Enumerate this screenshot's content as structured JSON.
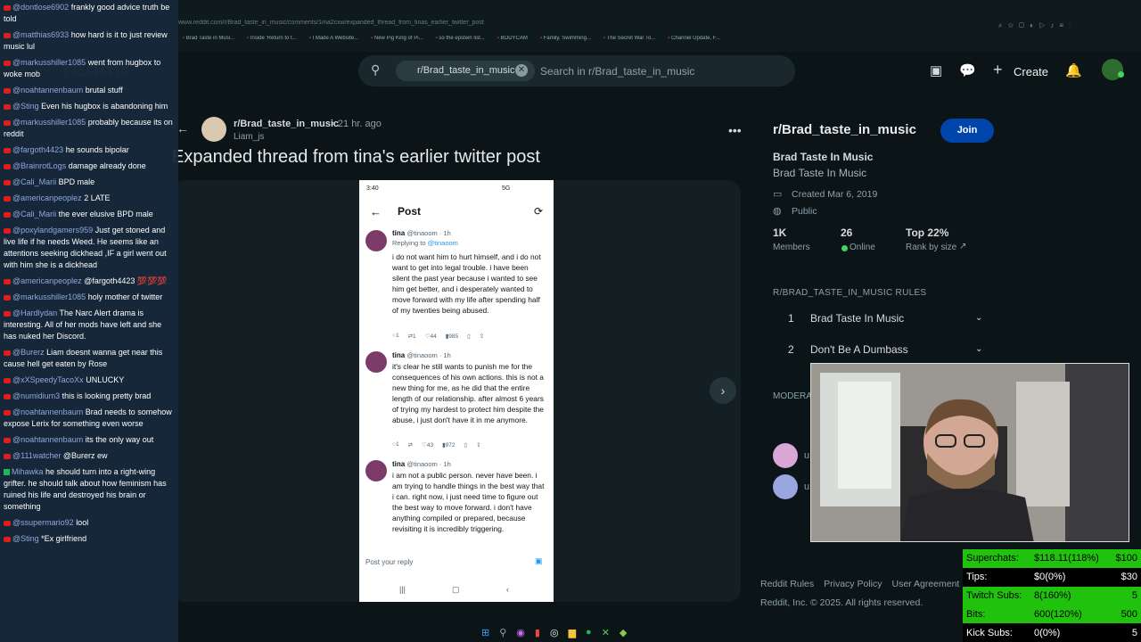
{
  "browser": {
    "url": "www.reddit.com/r/Brad_taste_in_music/comments/1ma2cxw/expanded_thread_from_tinas_earlier_twitter_post",
    "bookmarks": [
      "Brad Taste in Musi...",
      "Inside 'Return to t...",
      "I Made A Website...",
      "New Pig King of Pi...",
      "so the epstein list...",
      "BODYCAM",
      "Family, Swimming...",
      "The Secret War To...",
      "Channel Update, F..."
    ]
  },
  "reddit": {
    "logo": "reddit",
    "search": {
      "chip": "r/Brad_taste_in_music",
      "placeholder": "Search in r/Brad_taste_in_music"
    },
    "header": {
      "create_label": "Create"
    }
  },
  "post": {
    "subreddit": "r/Brad_taste_in_music",
    "time": "• 21 hr. ago",
    "author": "Liam_js",
    "title": "Expanded thread from tina's earlier twitter post"
  },
  "tweet_screenshot": {
    "status_time": "3:40",
    "status_right": "5G",
    "header": "Post",
    "tweets": [
      {
        "name": "tina",
        "handle": "@tinaoom · 1h",
        "reply_to_label": "Replying to",
        "reply_to": "@tinaoom",
        "text": "i do not want him to hurt himself, and i do not want to get into legal trouble. i have been silent the past year because i wanted to see him get better, and i desperately wanted to move forward with my life after spending half of my twenties being abused.",
        "replies": "1",
        "retweets": "1",
        "likes": "44",
        "views": "985"
      },
      {
        "name": "tina",
        "handle": "@tinaoom · 1h",
        "text": "it's clear he still wants to punish me for the consequences of his own actions. this is not a new thing for me, as he did that the entire length of our relationship. after almost 6 years of trying my hardest to protect him despite the abuse, i just don't have it in me anymore.",
        "replies": "1",
        "retweets": "",
        "likes": "43",
        "views": "972"
      },
      {
        "name": "tina",
        "handle": "@tinaoom · 1h",
        "text": "i am not a public person. never have been. i am trying to handle things in the best way that i can. right now, i just need time to figure out the best way to move forward. i don't have anything compiled or prepared, because revisiting it is incredibly triggering."
      }
    ],
    "reply_placeholder": "Post your reply"
  },
  "sidebar": {
    "title": "r/Brad_taste_in_music",
    "join_label": "Join",
    "display_name": "Brad Taste In Music",
    "description": "Brad Taste In Music",
    "created": "Created Mar 6, 2019",
    "visibility": "Public",
    "stats": [
      {
        "value": "1K",
        "label": "Members"
      },
      {
        "value": "26",
        "label": "Online"
      },
      {
        "value": "Top 22%",
        "label": "Rank by size"
      }
    ],
    "rules_heading": "R/BRAD_TASTE_IN_MUSIC RULES",
    "rules": [
      {
        "n": "1",
        "title": "Brad Taste In Music"
      },
      {
        "n": "2",
        "title": "Don't Be A Dumbass"
      }
    ],
    "moderators_heading": "MODERA",
    "mod_initial": "u",
    "footer_links": [
      "Reddit Rules",
      "Privacy Policy",
      "User Agreement",
      "Ac"
    ],
    "copyright": "Reddit, Inc. © 2025. All rights reserved."
  },
  "chat": [
    {
      "user": "@dontlose6902",
      "text": "frankly good advice truth be told"
    },
    {
      "user": "@matthias6933",
      "text": "how hard is it to just review music lul"
    },
    {
      "user": "@markusshiller1085",
      "text": "went from hugbox to woke mob"
    },
    {
      "user": "@noahtannenbaum",
      "text": "brutal stuff"
    },
    {
      "user": "@Sting",
      "text": "Even his hugbox is abandoning him"
    },
    {
      "user": "@markusshiller1085",
      "text": "probably because its on reddit"
    },
    {
      "user": "@fargoth4423",
      "text": "he sounds bipolar"
    },
    {
      "user": "@BrainrotLogs",
      "text": "damage already done"
    },
    {
      "user": "@Cali_Marii",
      "text": "BPD male"
    },
    {
      "user": "@americanpeoplez",
      "text": "2 LATE"
    },
    {
      "user": "@Cali_Marii",
      "text": "the ever elusive BPD male"
    },
    {
      "user": "@poxylandgamers959",
      "text": "Just get stoned and live life if he needs Weed. He seems like an attentions seeking dickhead ,IF a girl went out with him she is a dickhead"
    },
    {
      "user": "@americanpeoplez",
      "text": "@fargoth4423 💯💯💯"
    },
    {
      "user": "@markusshiller1085",
      "text": "holy mother of twitter"
    },
    {
      "user": "@Hardlydan",
      "text": "The Narc Alert drama is interesting. All of her mods have left and she has nuked her Discord."
    },
    {
      "user": "@Burerz",
      "text": "Liam doesnt wanna get near this cause hell get eaten by Rose"
    },
    {
      "user": "@xXSpeedyTacoXx",
      "text": "UNLUCKY"
    },
    {
      "user": "@numidium3",
      "text": "this is looking pretty brad"
    },
    {
      "user": "@noahtannenbaum",
      "text": "Brad needs to somehow expose Lerix for something even worse"
    },
    {
      "user": "@noahtannenbaum",
      "text": "its the only way out"
    },
    {
      "user": "@111watcher",
      "text": "@Burerz ew"
    },
    {
      "user": "Mihawka",
      "text": "he should turn into a right-wing grifter. he should talk about how feminism has ruined his life and destroyed his brain or something",
      "platform": "twitch"
    },
    {
      "user": "@ssupermario92",
      "text": "lool"
    },
    {
      "user": "@Sting",
      "text": "*Ex girlfriend"
    }
  ],
  "stats": [
    {
      "label": "Superchats:",
      "value": "$118.11(118%)",
      "max": "$100",
      "fill": 1.0
    },
    {
      "label": "Tips:",
      "value": "$0(0%)",
      "max": "$30",
      "fill": 0.0
    },
    {
      "label": "Twitch Subs:",
      "value": "8(160%)",
      "max": "5",
      "fill": 1.0
    },
    {
      "label": "Bits:",
      "value": "600(120%)",
      "max": "500",
      "fill": 1.0
    },
    {
      "label": "Kick Subs:",
      "value": "0(0%)",
      "max": "5",
      "fill": 0.0
    }
  ],
  "colors": {
    "accent": "#0045ac",
    "online": "#46d160",
    "stat_fill": "#20c20e",
    "chat_bg": "#16283a"
  }
}
